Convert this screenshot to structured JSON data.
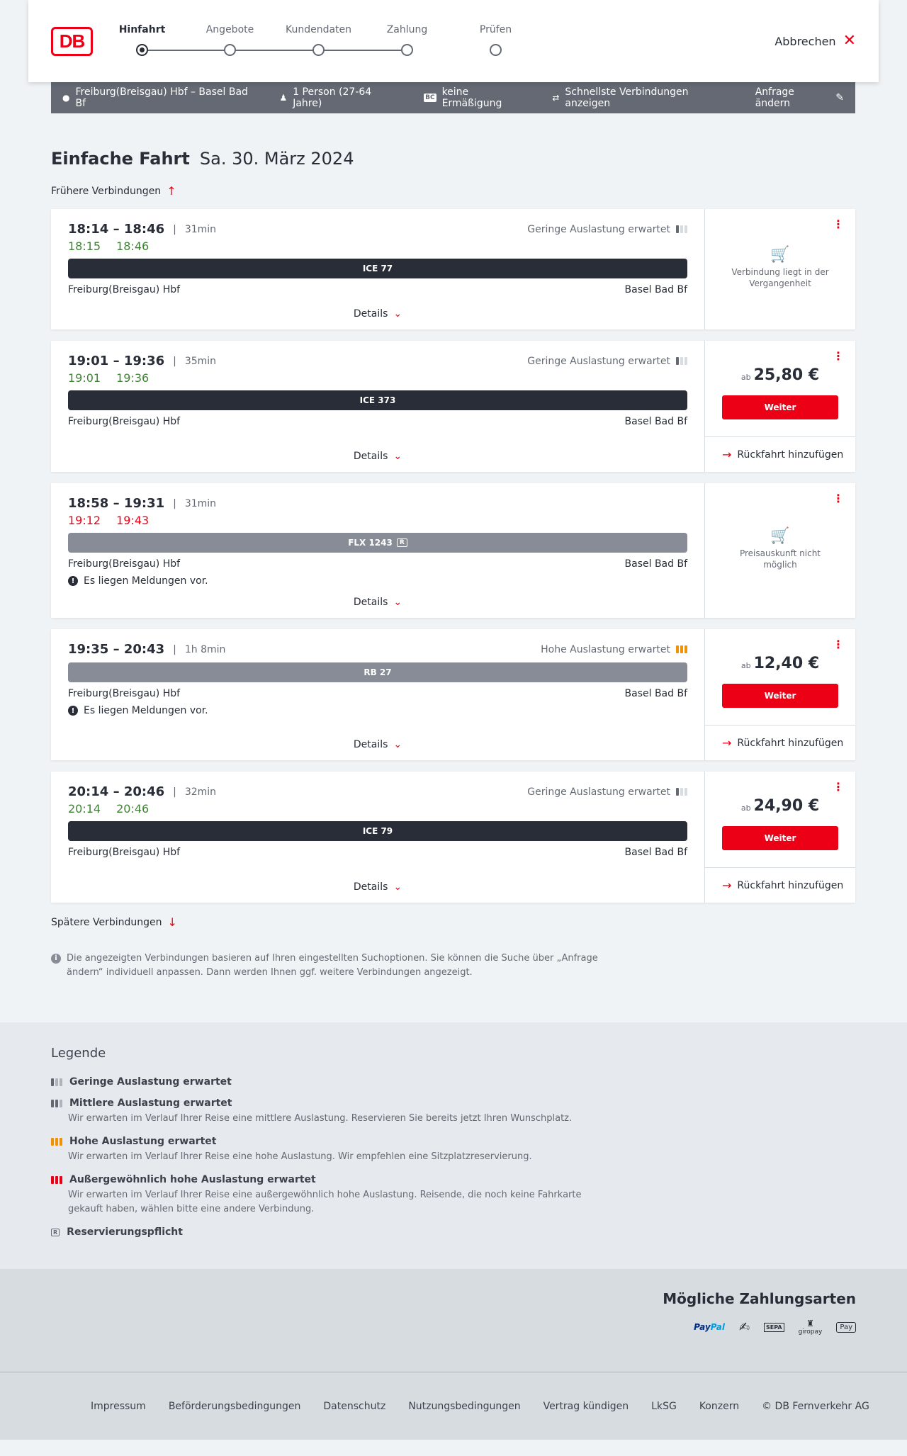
{
  "header": {
    "logo_text": "DB",
    "steps": [
      "Hinfahrt",
      "Angebote",
      "Kundendaten",
      "Zahlung",
      "Prüfen"
    ],
    "active_step": 0,
    "cancel_label": "Abbrechen"
  },
  "search": {
    "route": "Freiburg(Breisgau) Hbf – Basel Bad Bf",
    "travellers": "1 Person (27-64 Jahre)",
    "bc_badge": "BC",
    "discount": "keine Ermäßigung",
    "option": "Schnellste Verbindungen anzeigen",
    "edit_label": "Anfrage ändern"
  },
  "title": {
    "type": "Einfache Fahrt",
    "date": "Sa. 30. März 2024"
  },
  "earlier_label": "Frühere Verbindungen",
  "later_label": "Spätere Verbindungen",
  "details_label": "Details",
  "weiter_label": "Weiter",
  "return_label": "Rückfahrt hinzufügen",
  "ab_label": "ab",
  "connections": [
    {
      "times": "18:14 – 18:46",
      "duration": "31min",
      "occupancy": "Geringe Auslastung erwartet",
      "occ_level": "low",
      "rt_dep": "18:15",
      "rt_arr": "18:46",
      "rt_status": "green",
      "train": "ICE 77",
      "train_style": "dark",
      "reservation": false,
      "from": "Freiburg(Breisgau) Hbf",
      "to": "Basel Bad Bf",
      "message": null,
      "side": "info",
      "side_text": "Verbindung liegt in der Vergangenheit"
    },
    {
      "times": "19:01 – 19:36",
      "duration": "35min",
      "occupancy": "Geringe Auslastung erwartet",
      "occ_level": "low",
      "rt_dep": "19:01",
      "rt_arr": "19:36",
      "rt_status": "green",
      "train": "ICE 373",
      "train_style": "dark",
      "reservation": false,
      "from": "Freiburg(Breisgau) Hbf",
      "to": "Basel Bad Bf",
      "message": null,
      "side": "price",
      "price": "25,80 €"
    },
    {
      "times": "18:58 – 19:31",
      "duration": "31min",
      "occupancy": "",
      "occ_level": "none",
      "rt_dep": "19:12",
      "rt_arr": "19:43",
      "rt_status": "red",
      "train": "FLX 1243",
      "train_style": "grey",
      "reservation": true,
      "from": "Freiburg(Breisgau) Hbf",
      "to": "Basel Bad Bf",
      "message": "Es liegen Meldungen vor.",
      "side": "info",
      "side_text": "Preisauskunft nicht möglich"
    },
    {
      "times": "19:35 – 20:43",
      "duration": "1h 8min",
      "occupancy": "Hohe Auslastung erwartet",
      "occ_level": "high",
      "rt_dep": null,
      "rt_arr": null,
      "rt_status": "none",
      "train": "RB 27",
      "train_style": "grey",
      "reservation": false,
      "from": "Freiburg(Breisgau) Hbf",
      "to": "Basel Bad Bf",
      "message": "Es liegen Meldungen vor.",
      "side": "price",
      "price": "12,40 €"
    },
    {
      "times": "20:14 – 20:46",
      "duration": "32min",
      "occupancy": "Geringe Auslastung erwartet",
      "occ_level": "low",
      "rt_dep": "20:14",
      "rt_arr": "20:46",
      "rt_status": "green",
      "train": "ICE 79",
      "train_style": "dark",
      "reservation": false,
      "from": "Freiburg(Breisgau) Hbf",
      "to": "Basel Bad Bf",
      "message": null,
      "side": "price",
      "price": "24,90 €"
    }
  ],
  "notice": "Die angezeigten Verbindungen basieren auf Ihren eingestellten Suchoptionen. Sie können die Suche über „Anfrage ändern“ individuell anpassen. Dann werden Ihnen ggf. weitere Verbindungen angezeigt.",
  "legend": {
    "title": "Legende",
    "items": [
      {
        "icon": "low",
        "title": "Geringe Auslastung erwartet",
        "desc": ""
      },
      {
        "icon": "mid",
        "title": "Mittlere Auslastung erwartet",
        "desc": "Wir erwarten im Verlauf Ihrer Reise eine mittlere Auslastung. Reservieren Sie bereits jetzt Ihren Wunschplatz."
      },
      {
        "icon": "high",
        "title": "Hohe Auslastung erwartet",
        "desc": "Wir erwarten im Verlauf Ihrer Reise eine hohe Auslastung. Wir empfehlen eine Sitzplatzreservierung."
      },
      {
        "icon": "extreme",
        "title": "Außergewöhnlich hohe Auslastung erwartet",
        "desc": "Wir erwarten im Verlauf Ihrer Reise eine außergewöhnlich hohe Auslastung. Reisende, die noch keine Fahrkarte gekauft haben, wählen bitte eine andere Verbindung."
      },
      {
        "icon": "reservation",
        "title": "Reservierungspflicht",
        "desc": ""
      }
    ]
  },
  "payment": {
    "title": "Mögliche Zahlungsarten",
    "paypal_a": "Pay",
    "paypal_b": "Pal",
    "sepa": "SEPA",
    "giropay": "giropay",
    "applepay": "Pay"
  },
  "footer": {
    "links": [
      "Impressum",
      "Beförderungsbedingungen",
      "Datenschutz",
      "Nutzungsbedingungen",
      "Vertrag kündigen",
      "LkSG",
      "Konzern",
      "© DB Fernverkehr AG"
    ]
  },
  "colors": {
    "db_red": "#ec0016",
    "dark": "#282d37",
    "grey_bar": "#878c96",
    "realtime_green": "#408335",
    "high_occupancy": "#f39200"
  }
}
